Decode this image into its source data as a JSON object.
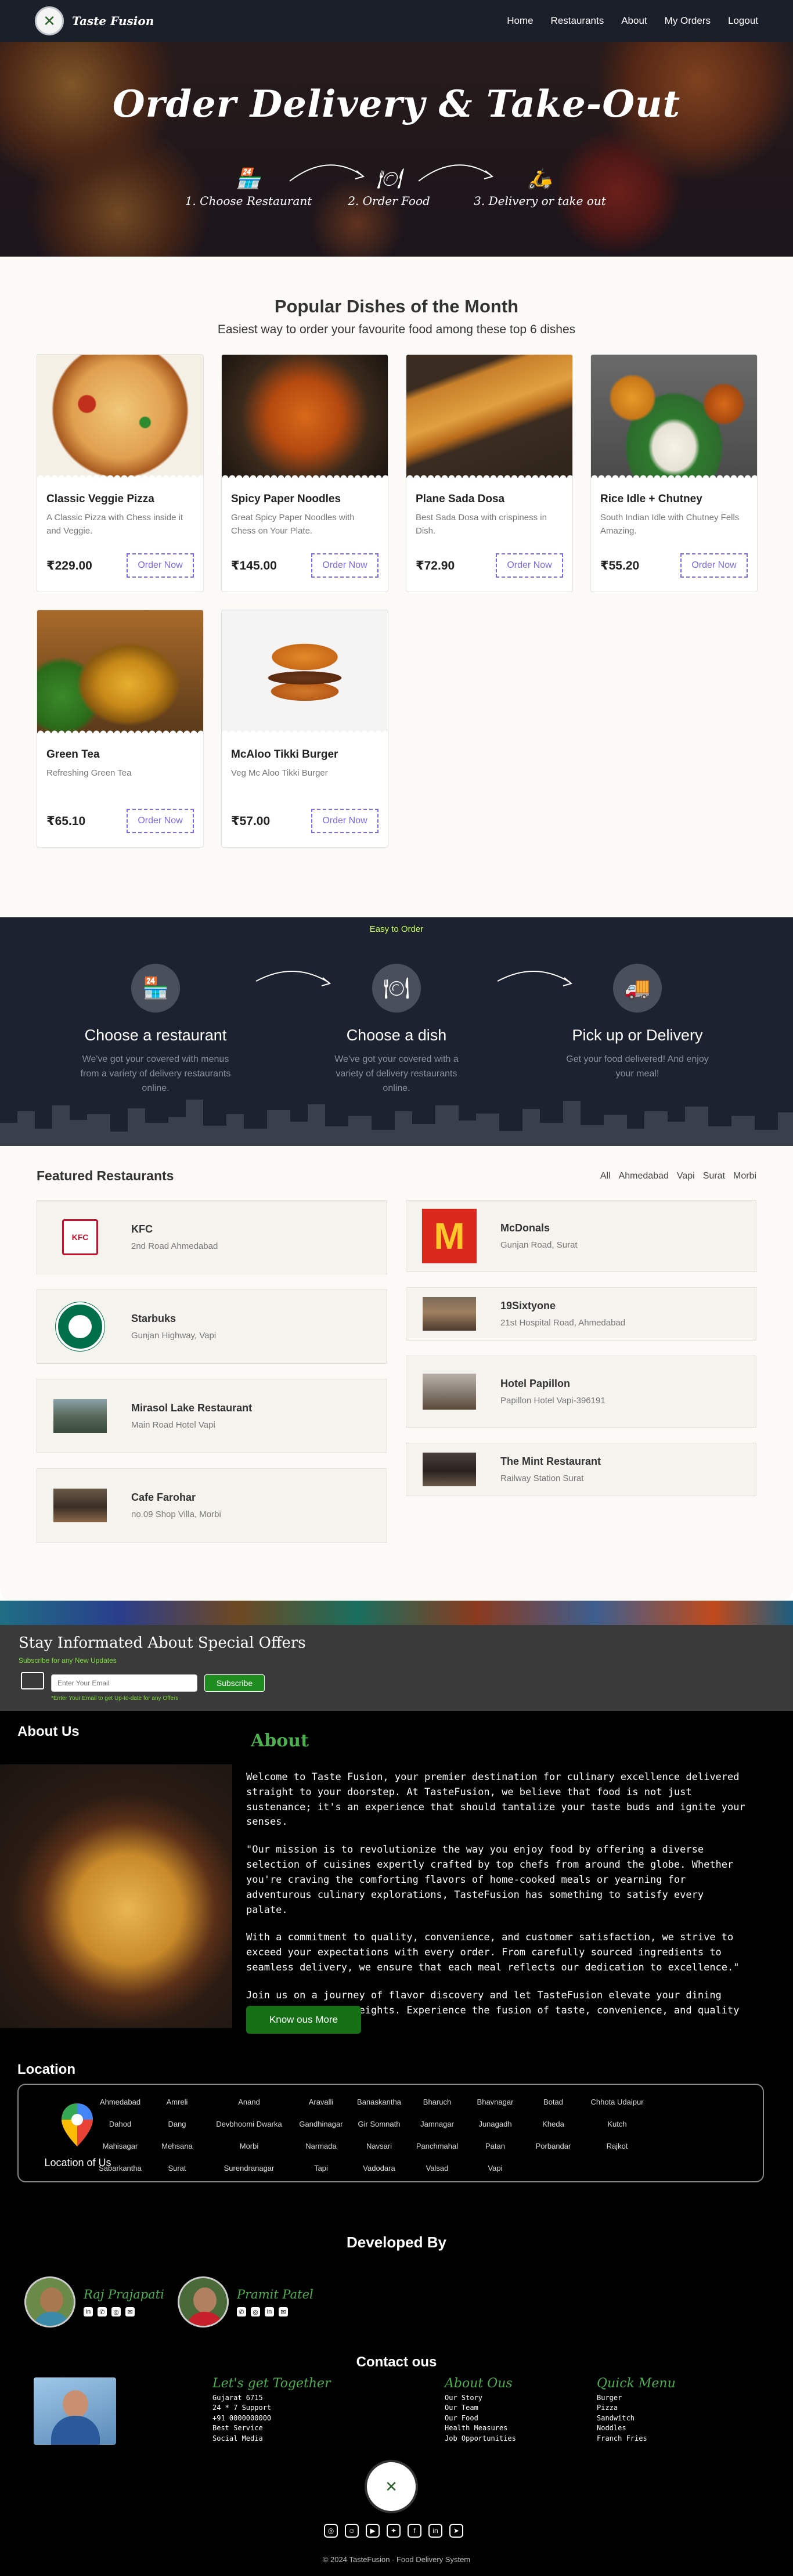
{
  "nav": {
    "brand": "Taste Fusion",
    "links": [
      "Home",
      "Restaurants",
      "About",
      "My Orders",
      "Logout"
    ]
  },
  "hero": {
    "title": "Order Delivery & Take-Out",
    "steps": [
      "1. Choose Restaurant",
      "2. Order Food",
      "3. Delivery or take out"
    ]
  },
  "popular": {
    "title": "Popular Dishes of the Month",
    "subtitle": "Easiest way to order your favourite food among these top 6 dishes",
    "order_label": "Order Now",
    "dishes": [
      {
        "name": "Classic Veggie Pizza",
        "desc": "A Classic Pizza with Chess inside it and Veggie.",
        "price": "₹229.00"
      },
      {
        "name": "Spicy Paper Noodles",
        "desc": "Great Spicy Paper Noodles with Chess on Your Plate.",
        "price": "₹145.00"
      },
      {
        "name": "Plane Sada Dosa",
        "desc": "Best Sada Dosa with crispiness in Dish.",
        "price": "₹72.90"
      },
      {
        "name": "Rice Idle + Chutney",
        "desc": "South Indian Idle with Chutney Fells Amazing.",
        "price": "₹55.20"
      },
      {
        "name": "Green Tea",
        "desc": "Refreshing Green Tea",
        "price": "₹65.10"
      },
      {
        "name": "McAloo Tikki Burger",
        "desc": "Veg Mc Aloo Tikki Burger",
        "price": "₹57.00"
      }
    ]
  },
  "easy": {
    "label": "Easy to Order",
    "steps": [
      {
        "title": "Choose a restaurant",
        "text": "We've got your covered with menus from a variety of delivery restaurants online."
      },
      {
        "title": "Choose a dish",
        "text": "We've got your covered with a variety of delivery restaurants online."
      },
      {
        "title": "Pick up or Delivery",
        "text": "Get your food delivered! And enjoy your meal!"
      }
    ]
  },
  "featured": {
    "title": "Featured Restaurants",
    "filters": [
      "All",
      "Ahmedabad",
      "Vapi",
      "Surat",
      "Morbi"
    ],
    "left": [
      {
        "name": "KFC",
        "address": "2nd Road Ahmedabad"
      },
      {
        "name": "Starbuks",
        "address": "Gunjan Highway, Vapi"
      },
      {
        "name": "Mirasol Lake Restaurant",
        "address": "Main Road Hotel Vapi"
      },
      {
        "name": "Cafe Farohar",
        "address": "no.09 Shop Villa, Morbi"
      }
    ],
    "right": [
      {
        "name": "McDonals",
        "address": "Gunjan Road, Surat"
      },
      {
        "name": "19Sixtyone",
        "address": "21st Hospital Road, Ahmedabad"
      },
      {
        "name": "Hotel Papillon",
        "address": "Papillon Hotel Vapi-396191"
      },
      {
        "name": "The Mint Restaurant",
        "address": "Railway Station Surat"
      }
    ]
  },
  "newsletter": {
    "title": "Stay Informated About Special Offers",
    "subtitle": "Subscribe for any New Updates",
    "placeholder": "Enter Your Email",
    "button": "Subscribe",
    "note": "*Enter Your Email to get Up-to-date for any Offers"
  },
  "about": {
    "heading": "About Us",
    "title": "About",
    "paragraphs": [
      "Welcome to Taste Fusion, your premier destination for culinary excellence delivered straight to your doorstep. At TasteFusion, we believe that food is not just sustenance; it's an experience that should tantalize your taste buds and ignite your senses.",
      "\"Our mission is to revolutionize the way you enjoy food by offering a diverse selection of cuisines expertly crafted by top chefs from around the globe. Whether you're craving the comforting flavors of home-cooked meals or yearning for adventurous culinary explorations, TasteFusion has something to satisfy every palate.",
      "With a commitment to quality, convenience, and customer satisfaction, we strive to exceed your expectations with every order. From carefully sourced ingredients to seamless delivery, we ensure that each meal reflects our dedication to excellence.\"",
      "Join us on a journey of flavor discovery and let TasteFusion elevate your dining experience to new heights. Experience the fusion of taste, convenience, and quality with every bite."
    ],
    "button": "Know ous More"
  },
  "location": {
    "heading": "Location",
    "caption": "Location of Us",
    "rows": [
      [
        "Ahmedabad",
        "Amreli",
        "Anand",
        "Aravalli",
        "Banaskantha",
        "Bharuch",
        "Bhavnagar",
        "Botad",
        "Chhota Udaipur"
      ],
      [
        "Dahod",
        "Dang",
        "Devbhoomi Dwarka",
        "Gandhinagar",
        "Gir Somnath",
        "Jamnagar",
        "Junagadh",
        "Kheda",
        "Kutch"
      ],
      [
        "Mahisagar",
        "Mehsana",
        "Morbi",
        "Narmada",
        "Navsari",
        "Panchmahal",
        "Patan",
        "Porbandar",
        "Rajkot"
      ],
      [
        "Sabarkantha",
        "Surat",
        "Surendranagar",
        "Tapi",
        "Vadodara",
        "Valsad",
        "Vapi"
      ]
    ]
  },
  "developers": {
    "heading": "Developed By",
    "people": [
      "Raj Prajapati",
      "Pramit Patel"
    ]
  },
  "contact": {
    "heading": "Contact ous",
    "columns": [
      {
        "title": "Let's get Together",
        "items": [
          "Gujarat 6715",
          "24 * 7 Support",
          "+91 0000000000",
          "Best Service",
          "Social Media"
        ]
      },
      {
        "title": "About Ous",
        "items": [
          "Our Story",
          "Our Team",
          "Our Food",
          "Health Measures",
          "Job Opportunities"
        ]
      },
      {
        "title": "Quick Menu",
        "items": [
          "Burger",
          "Pizza",
          "Sandwitch",
          "Noddles",
          "Franch Fries"
        ]
      }
    ],
    "copyright": "© 2024 TasteFusion - Food Delivery System"
  },
  "colors": {
    "accent_green": "#4caf50",
    "order_button": "#7b68ee",
    "nav_bg": "#1b1f2a"
  }
}
